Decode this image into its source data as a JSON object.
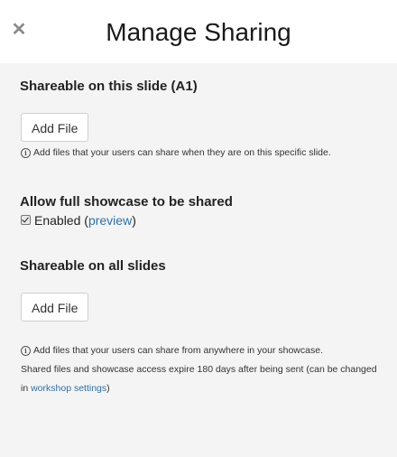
{
  "header": {
    "title": "Manage Sharing",
    "close_icon": "close-icon"
  },
  "slide_section": {
    "title": "Shareable on this slide (A1)",
    "add_button_label": "Add File",
    "help_text": "Add files that your users can share when they are on this specific slide."
  },
  "showcase_section": {
    "title": "Allow full showcase to be shared",
    "checkbox_checked": true,
    "enabled_label": "Enabled (",
    "preview_link": "preview",
    "enabled_suffix": ")"
  },
  "all_slides_section": {
    "title": "Shareable on all slides",
    "add_button_label": "Add File",
    "help_text_1": "Add files that your users can share from anywhere in your showcase.",
    "help_text_2": "Shared files and showcase access expire 180 days after being sent (can be changed in ",
    "settings_link": "workshop settings",
    "help_text_3": ")"
  },
  "colors": {
    "background": "#f4f4f4",
    "header_background": "#ffffff",
    "link": "#2f6fa7"
  }
}
